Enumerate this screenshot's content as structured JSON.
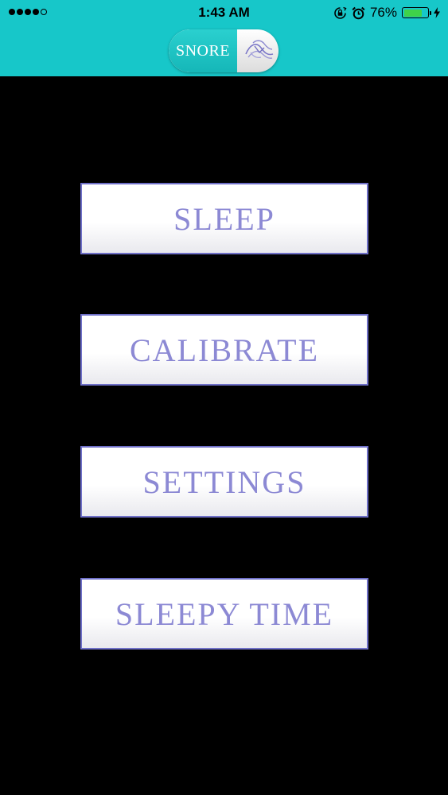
{
  "status_bar": {
    "time": "1:43 AM",
    "battery_percent": "76%",
    "battery_level": 0.76,
    "signal_bars": 4,
    "icons": [
      "signal-dots-icon",
      "rotation-lock-icon",
      "alarm-icon",
      "battery-icon",
      "charging-bolt-icon"
    ]
  },
  "header": {
    "logo_text": "SNORE",
    "logo_icon": "snore-logo-mark-icon",
    "background_color": "#17c7c9"
  },
  "menu": {
    "sleep": "SLEEP",
    "calibrate": "CALIBRATE",
    "settings": "SETTINGS",
    "sleepy_time": "SLEEPY TIME",
    "text_color": "#8c89d4",
    "border_color": "#6f70c8"
  }
}
